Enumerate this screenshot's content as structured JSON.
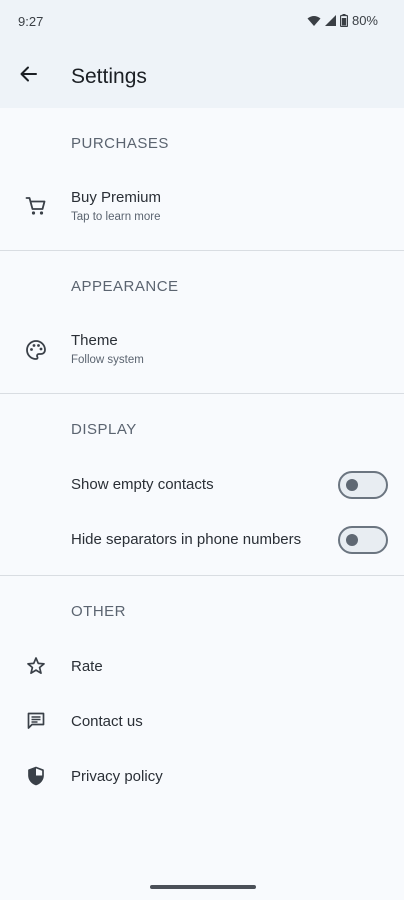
{
  "status": {
    "time": "9:27",
    "battery": "80%"
  },
  "app_bar": {
    "title": "Settings"
  },
  "sections": {
    "purchases": {
      "header": "PURCHASES",
      "buy_premium": {
        "title": "Buy Premium",
        "subtitle": "Tap to learn more",
        "icon": "cart-icon"
      }
    },
    "appearance": {
      "header": "APPEARANCE",
      "theme": {
        "title": "Theme",
        "subtitle": "Follow system",
        "icon": "palette-icon"
      }
    },
    "display": {
      "header": "DISPLAY",
      "show_empty_contacts": {
        "title": "Show empty contacts",
        "enabled": false
      },
      "hide_separators": {
        "title": "Hide separators in phone numbers",
        "enabled": false
      }
    },
    "other": {
      "header": "OTHER",
      "rate": {
        "title": "Rate",
        "icon": "star-icon"
      },
      "contact": {
        "title": "Contact us",
        "icon": "chat-icon"
      },
      "privacy": {
        "title": "Privacy policy",
        "icon": "shield-icon"
      }
    }
  }
}
